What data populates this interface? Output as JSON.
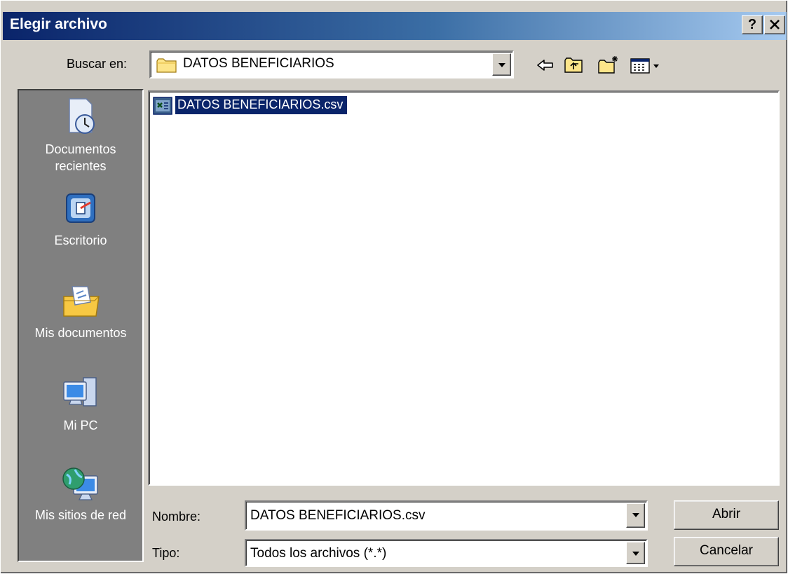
{
  "window": {
    "title": "Elegir archivo",
    "help_label": "?",
    "close_label": "✕"
  },
  "lookin": {
    "label": "Buscar en:",
    "value": "DATOS BENEFICIARIOS"
  },
  "toolbar": {
    "icons": [
      "back-icon",
      "up-folder-icon",
      "new-folder-icon",
      "view-menu-icon"
    ]
  },
  "places": [
    {
      "label": "Documentos\nrecientes",
      "icon": "recent-documents-icon"
    },
    {
      "label": "Escritorio",
      "icon": "desktop-icon"
    },
    {
      "label": "Mis documentos",
      "icon": "my-documents-icon"
    },
    {
      "label": "Mi PC",
      "icon": "my-computer-icon"
    },
    {
      "label": "Mis sitios de red",
      "icon": "network-places-icon"
    }
  ],
  "files": [
    {
      "name": "DATOS BENEFICIARIOS.csv",
      "selected": true,
      "icon": "csv-file-icon"
    }
  ],
  "filename": {
    "label": "Nombre:",
    "value": "DATOS BENEFICIARIOS.csv"
  },
  "filetype": {
    "label": "Tipo:",
    "value": "Todos los archivos (*.*)"
  },
  "buttons": {
    "open": "Abrir",
    "cancel": "Cancelar"
  },
  "colors": {
    "titlebar_start": "#0a246a",
    "titlebar_end": "#a6caf0",
    "selection": "#0a246a",
    "face": "#d4d0c8"
  }
}
